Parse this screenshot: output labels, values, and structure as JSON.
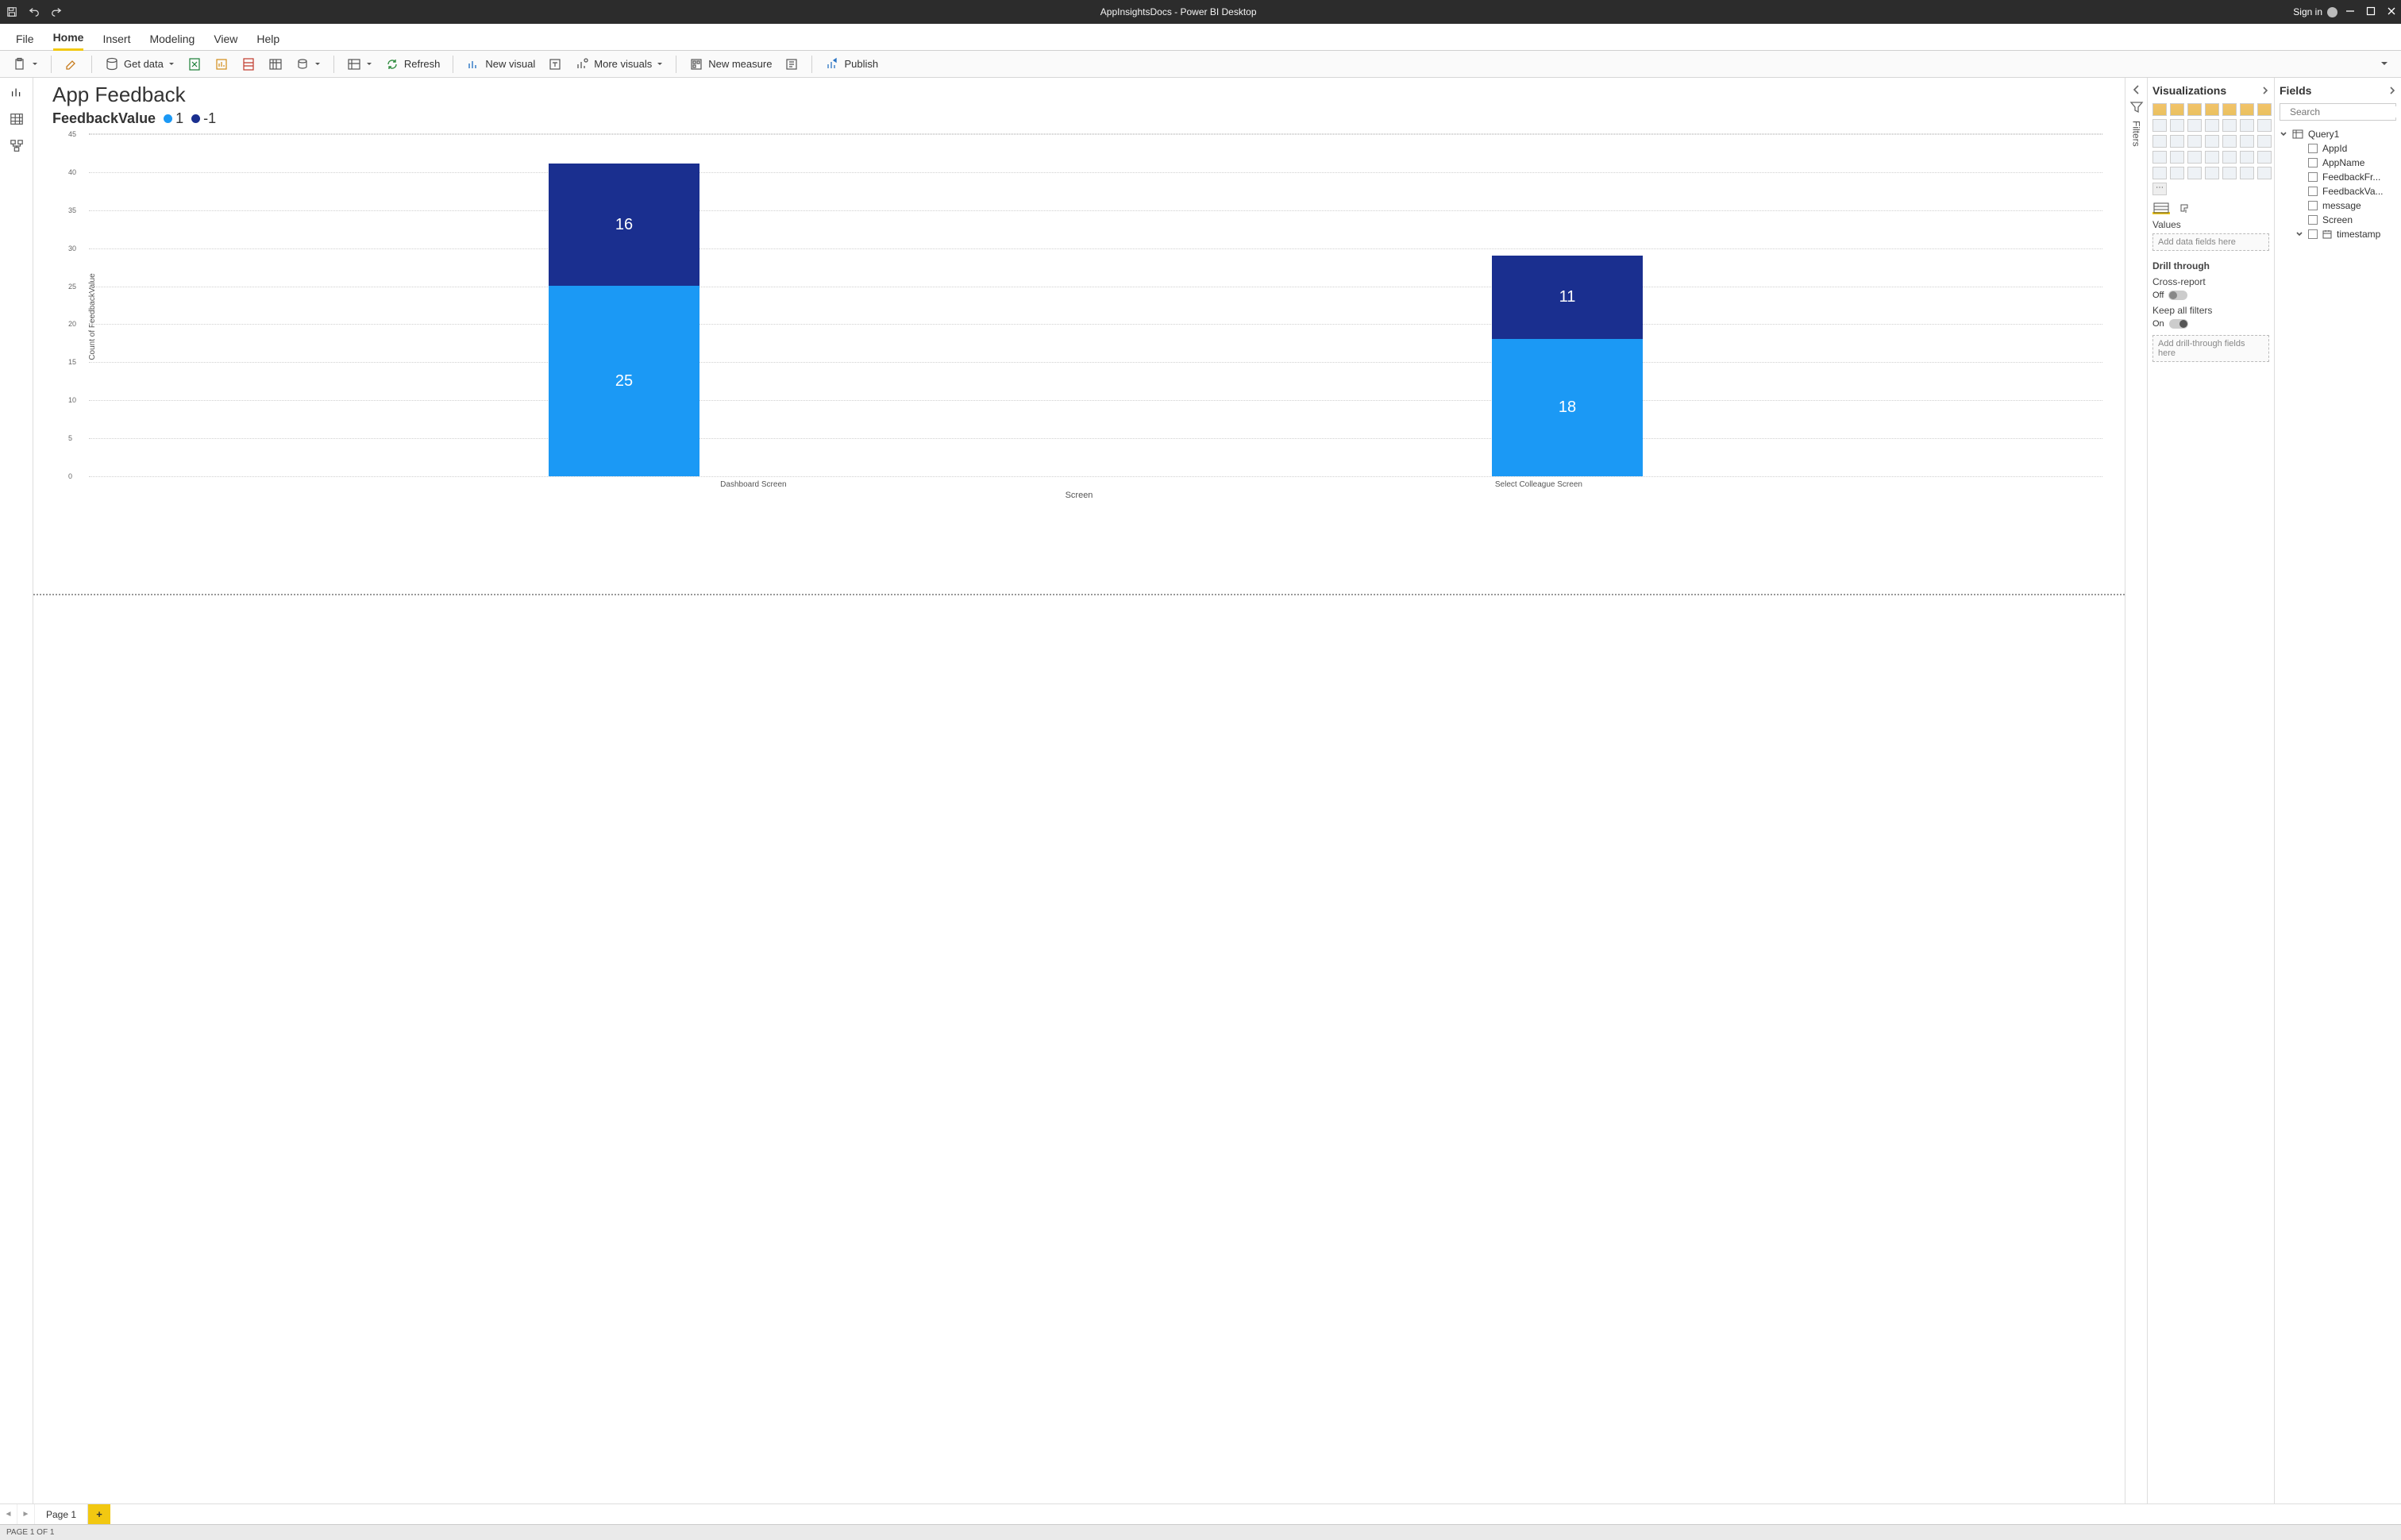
{
  "titlebar": {
    "title": "AppInsightsDocs - Power BI Desktop",
    "signin": "Sign in"
  },
  "ribbon_tabs": [
    "File",
    "Home",
    "Insert",
    "Modeling",
    "View",
    "Help"
  ],
  "active_tab": "Home",
  "ribbon": {
    "get_data": "Get data",
    "refresh": "Refresh",
    "new_visual": "New visual",
    "more_visuals": "More visuals",
    "new_measure": "New measure",
    "publish": "Publish"
  },
  "chart_title": "App Feedback",
  "legend_title": "FeedbackValue",
  "chart_data": {
    "type": "bar",
    "stacked": true,
    "categories": [
      "Dashboard Screen",
      "Select Colleague Screen"
    ],
    "series": [
      {
        "name": "1",
        "color": "#1b99f5",
        "values": [
          25,
          18
        ]
      },
      {
        "name": "-1",
        "color": "#1a2f8f",
        "values": [
          16,
          11
        ]
      }
    ],
    "xlabel": "Screen",
    "ylabel": "Count of FeedbackValue",
    "ylim": [
      0,
      45
    ],
    "yticks": [
      0,
      5,
      10,
      15,
      20,
      25,
      30,
      35,
      40,
      45
    ]
  },
  "filters_label": "Filters",
  "viz": {
    "pane_title": "Visualizations",
    "values_label": "Values",
    "values_placeholder": "Add data fields here",
    "drill_title": "Drill through",
    "cross_report_label": "Cross-report",
    "cross_report_state": "Off",
    "keep_filters_label": "Keep all filters",
    "keep_filters_state": "On",
    "drill_placeholder": "Add drill-through fields here"
  },
  "fields": {
    "pane_title": "Fields",
    "search_placeholder": "Search",
    "table": "Query1",
    "columns": [
      "AppId",
      "AppName",
      "FeedbackFr...",
      "FeedbackVa...",
      "message",
      "Screen",
      "timestamp"
    ]
  },
  "pages": {
    "page_name": "Page 1"
  },
  "status": {
    "text": "PAGE 1 OF 1"
  }
}
